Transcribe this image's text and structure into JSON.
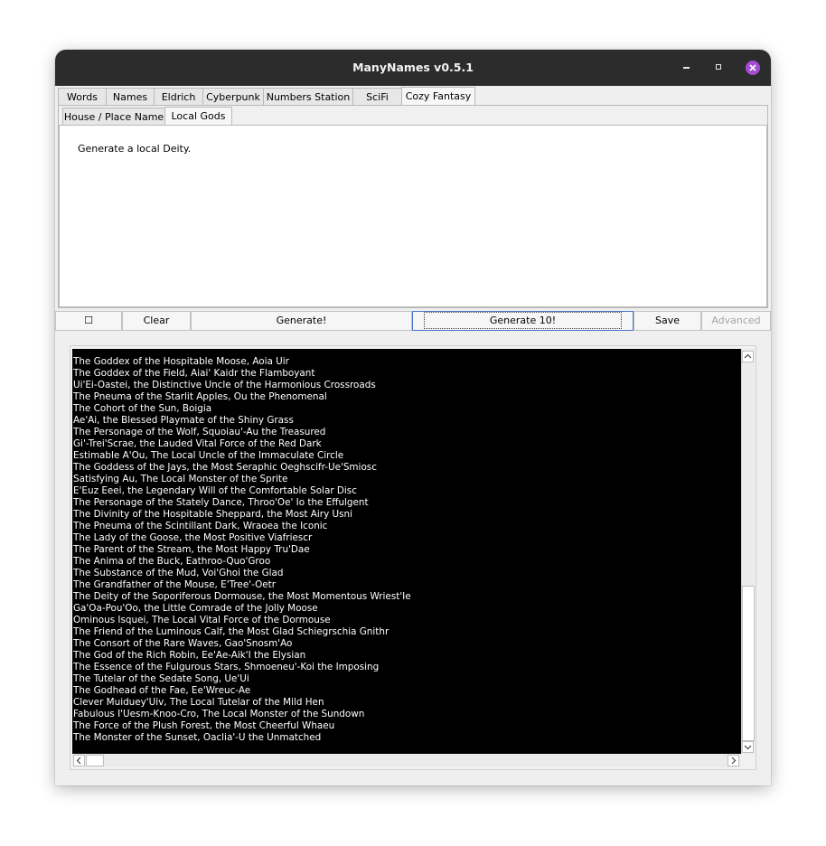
{
  "window": {
    "title": "ManyNames v0.5.1"
  },
  "main_tabs": [
    {
      "label": "Words"
    },
    {
      "label": "Names"
    },
    {
      "label": "Eldrich"
    },
    {
      "label": "Cyberpunk"
    },
    {
      "label": "Numbers Station"
    },
    {
      "label": "SciFi"
    },
    {
      "label": "Cozy Fantasy"
    }
  ],
  "sub_tabs": [
    {
      "label": "House / Place Name"
    },
    {
      "label": "Local Gods"
    }
  ],
  "description": "Generate a local Deity.",
  "buttons": {
    "checkbox_label": "☐",
    "clear": "Clear",
    "generate": "Generate!",
    "generate10": "Generate 10!",
    "save": "Save",
    "advanced": "Advanced"
  },
  "output_lines": [
    "The Goddex of the Hospitable Moose, Aoia Uir",
    "The Goddex of the Field, Aiai' Kaidr the Flamboyant",
    "Ui'Ei-Oastei, the Distinctive Uncle of the Harmonious Crossroads",
    "The Pneuma of the Starlit Apples, Ou the Phenomenal",
    "The Cohort of the Sun, Boigia",
    "Ae'Ai, the Blessed Playmate of the Shiny Grass",
    "The Personage of the Wolf, Squoiau'-Au the Treasured",
    "Gi'-Trei'Scrae, the Lauded Vital Force of the Red Dark",
    "Estimable A'Ou, The Local Uncle of the Immaculate Circle",
    "The Goddess of the Jays, the Most Seraphic Oeghscifr-Ue'Smiosc",
    "Satisfying Au, The Local Monster of the Sprite",
    "E'Euz Eeei, the Legendary Will of the Comfortable Solar Disc",
    "The Personage of the Stately Dance, Throo'Oe' Io the Effulgent",
    "The Divinity of the Hospitable Sheppard, the Most Airy Usni",
    "The Pneuma of the Scintillant Dark, Wraoea the Iconic",
    "The Lady of the Goose, the Most Positive Viafriescr",
    "The Parent of the Stream, the Most Happy Tru'Dae",
    "The Anima of the Buck, Eathroo-Quo'Groo",
    "The Substance of the Mud, Voi'Ghoi the Glad",
    "The Grandfather of the Mouse, E'Tree'-Oetr",
    "The Deity of the Soporiferous Dormouse, the Most Momentous Wriest'Ie",
    "Ga'Oa-Pou'Oo, the Little Comrade of the Jolly Moose",
    "Ominous Isquei, The Local Vital Force of the Dormouse",
    "The Friend of the Luminous Calf, the Most Glad Schiegrschia Gnithr",
    "The Consort of the Rare Waves, Gao'Snosm'Ao",
    "The God of the Rich Robin, Ee'Ae-Aik'I the Elysian",
    "The Essence of the Fulgurous Stars, Shmoeneu'-Koi the Imposing",
    "The Tutelar of the Sedate Song, Ue'Ui",
    "The Godhead of the Fae, Ee'Wreuc-Ae",
    "Clever Muiduey'Uiv, The Local Tutelar of the Mild Hen",
    "Fabulous I'Uesm-Knoo-Cro, The Local Monster of the Sundown",
    "The Force of the Plush Forest, the Most Cheerful Whaeu",
    "The Monster of the Sunset, Oaclia'-U the Unmatched"
  ]
}
